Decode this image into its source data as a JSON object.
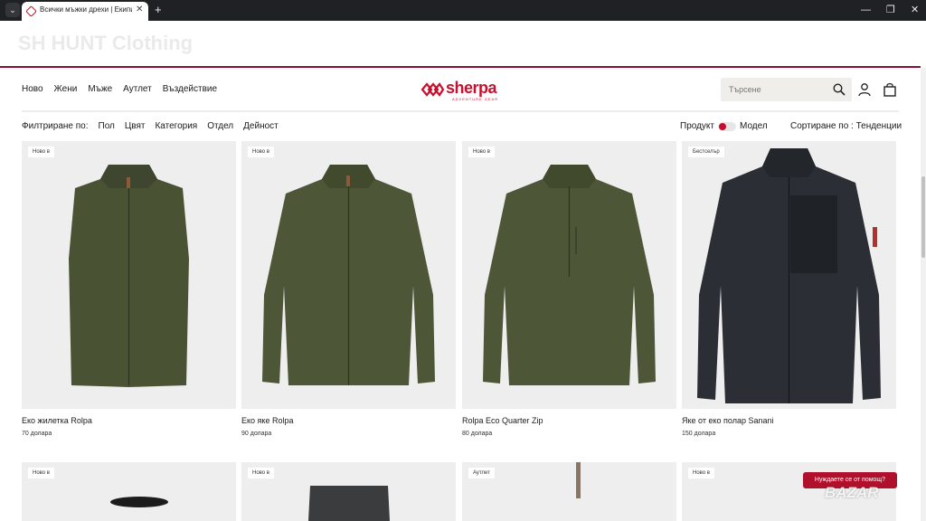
{
  "browser": {
    "tab_title": "Всички мъжки дрехи | Екипир...",
    "new_tab": "+",
    "close": "✕",
    "minimize": "—",
    "maximize": "❐",
    "close_window": "✕"
  },
  "banner": {
    "text": "SH HUNT Clothing"
  },
  "nav": {
    "items": [
      "Ново",
      "Жени",
      "Мъже",
      "Аутлет",
      "Въздействие"
    ]
  },
  "logo": {
    "word": "sherpa",
    "tagline": "ADVENTURE GEAR"
  },
  "search": {
    "placeholder": "Търсене"
  },
  "filters": {
    "label": "Филтриране по:",
    "items": [
      "Пол",
      "Цвят",
      "Категория",
      "Отдел",
      "Дейност"
    ],
    "toggle_left": "Продукт",
    "toggle_right": "Модел",
    "sort": "Сортиране по : Тенденции"
  },
  "products": [
    {
      "badge": "Ново в",
      "name": "Еко жилетка Rolpa",
      "price": "70 долара",
      "color": "#4a5234"
    },
    {
      "badge": "Ново в",
      "name": "Еко яке Rolpa",
      "price": "90 долара",
      "color": "#4d5636"
    },
    {
      "badge": "Ново в",
      "name": "Rolpa Eco Quarter Zip",
      "price": "80 долара",
      "color": "#4d5636"
    },
    {
      "badge": "Бестселър",
      "name": "Яке от еко полар Sanani",
      "price": "150 долара",
      "color": "#2b2f35"
    }
  ],
  "row2_badges": [
    "Ново в",
    "Ново в",
    "Аутлет",
    "Ново в"
  ],
  "help": "Нуждаете се от помощ?",
  "watermark": "BAZAR",
  "colors": {
    "brand": "#c8102e",
    "banner_line": "#8a1030",
    "card_bg": "#eeeeee"
  }
}
